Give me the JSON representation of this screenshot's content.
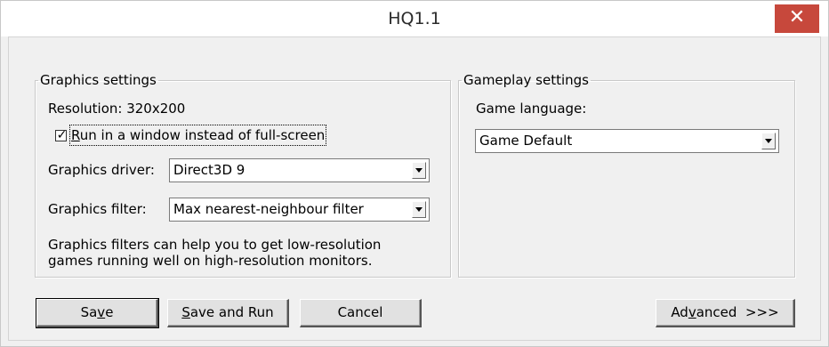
{
  "window": {
    "title": "HQ1.1",
    "close_glyph": "✕"
  },
  "graphics": {
    "legend": "Graphics settings",
    "resolution_label": "Resolution: 320x200",
    "run_in_window": {
      "checked": true,
      "label_mnemonic": "R",
      "label_rest": "un in a window instead of full-screen"
    },
    "driver": {
      "label": "Graphics driver:",
      "value": "Direct3D 9"
    },
    "filter": {
      "label": "Graphics filter:",
      "value": "Max nearest-neighbour filter"
    },
    "help_line1": "Graphics filters can help you to get low-resolution",
    "help_line2": "games running well on high-resolution monitors."
  },
  "gameplay": {
    "legend": "Gameplay settings",
    "language_label": "Game language:",
    "language_value": "Game Default"
  },
  "buttons": {
    "save": {
      "pre": "Sa",
      "mnemonic": "v",
      "post": "e"
    },
    "save_and_run": {
      "pre": "",
      "mnemonic": "S",
      "post": "ave and Run"
    },
    "cancel": "Cancel",
    "advanced": {
      "pre": "Ad",
      "mnemonic": "v",
      "post": "anced  >>>"
    }
  },
  "icons": {
    "close": "close-icon",
    "dropdown": "chevron-down-icon",
    "check": "checkmark-icon"
  }
}
